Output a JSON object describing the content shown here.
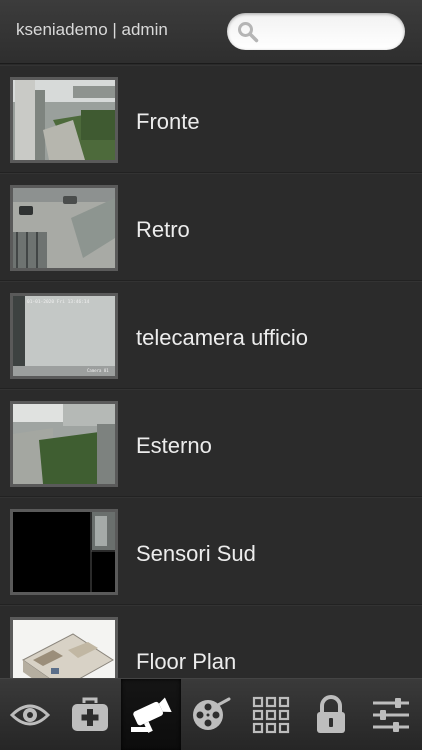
{
  "header": {
    "user_label": "kseniademo | admin",
    "search": {
      "value": "",
      "placeholder": ""
    }
  },
  "cameras": [
    {
      "label": "Fronte",
      "thumb": "parking-lot-front"
    },
    {
      "label": "Retro",
      "thumb": "parking-lot-rear"
    },
    {
      "label": "telecamera ufficio",
      "thumb": "office-wall",
      "overlay_time": "01-01-2020 Fri 13:46:14",
      "overlay_name": "Camera 01"
    },
    {
      "label": "Esterno",
      "thumb": "outdoor-hedge"
    },
    {
      "label": "Sensori Sud",
      "thumb": "multi-view-dark"
    },
    {
      "label": "Floor Plan",
      "thumb": "floor-plan"
    }
  ],
  "tabbar": {
    "items": [
      {
        "icon": "eye-icon"
      },
      {
        "icon": "first-aid-kit-icon"
      },
      {
        "icon": "security-camera-icon",
        "active": true
      },
      {
        "icon": "film-reel-icon"
      },
      {
        "icon": "grid-icon"
      },
      {
        "icon": "lock-icon"
      },
      {
        "icon": "sliders-icon"
      }
    ]
  },
  "colors": {
    "background": "#2a2a2a",
    "active_tab": "#111111",
    "text": "#ececec"
  }
}
